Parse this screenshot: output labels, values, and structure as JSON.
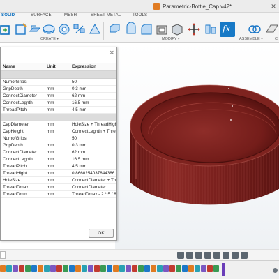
{
  "titlebar": {
    "document_title": "Parametric-Bottle_Cap v42*"
  },
  "workspace_tabs": [
    "SOLID",
    "SURFACE",
    "MESH",
    "SHEET METAL",
    "TOOLS"
  ],
  "ribbon_groups": {
    "create": "CREATE ▾",
    "modify": "MODIFY ▾",
    "assemble": "ASSEMBLE ▾",
    "construct": "C"
  },
  "dialog": {
    "columns": [
      "Name",
      "Unit",
      "Expression"
    ],
    "rows_group1": [
      {
        "name": "NumofGrips",
        "unit": "",
        "expression": "50"
      },
      {
        "name": "GripDepth",
        "unit": "mm",
        "expression": "0.3 mm"
      },
      {
        "name": "ConnectDiameter",
        "unit": "mm",
        "expression": "62 mm"
      },
      {
        "name": "ConnectLegnth",
        "unit": "mm",
        "expression": "16.5 mm"
      },
      {
        "name": "ThreadPitch",
        "unit": "mm",
        "expression": "4.5 mm"
      }
    ],
    "rows_group2": [
      {
        "name": "CapDiameter",
        "unit": "mm",
        "expression": "HoleSize + ThreadHight"
      },
      {
        "name": "CapHeight",
        "unit": "mm",
        "expression": "ConnectLegnth + Thre"
      },
      {
        "name": "NumofGrips",
        "unit": "",
        "expression": "50"
      },
      {
        "name": "GripDepth",
        "unit": "mm",
        "expression": "0.3 mm"
      },
      {
        "name": "ConnectDiameter",
        "unit": "mm",
        "expression": "62 mm"
      },
      {
        "name": "ConnectLegnth",
        "unit": "mm",
        "expression": "16.5 mm"
      },
      {
        "name": "ThreadPitch",
        "unit": "mm",
        "expression": "4.5 mm"
      },
      {
        "name": "ThreadHight",
        "unit": "mm",
        "expression": "0.8660254037844386 *"
      },
      {
        "name": "HoleSize",
        "unit": "mm",
        "expression": "ConnectDiameter + Th"
      },
      {
        "name": "ThreadDmax",
        "unit": "mm",
        "expression": "ConnectDiameter"
      },
      {
        "name": "ThreadDmin",
        "unit": "mm",
        "expression": "ThreadDmax - 2 * 5 / 8"
      }
    ],
    "ok_label": "OK"
  },
  "colors": {
    "accent": "#0b6fbf",
    "cap": "#7a1f1c",
    "timeline_marker": "#6a3db8"
  },
  "icons": [
    "new-component-icon",
    "sketch-icon",
    "extrude-icon",
    "revolve-icon",
    "hole-icon",
    "pattern-icon",
    "press-pull-icon",
    "fillet-icon",
    "chamfer-icon",
    "shell-icon",
    "split-icon",
    "move-icon",
    "parameters-fx-icon",
    "joint-icon",
    "plane-icon",
    "orbit-icon",
    "pan-icon",
    "zoom-icon",
    "look-at-icon",
    "display-settings-icon",
    "grid-icon",
    "viewport-icon"
  ]
}
